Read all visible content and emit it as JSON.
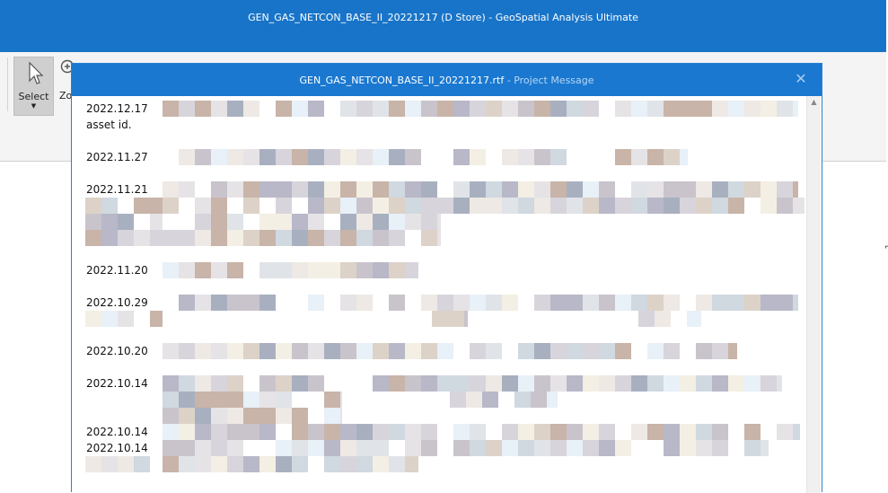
{
  "app": {
    "window_title": "GEN_GAS_NETCON_BASE_II_20221217 (D Store) - GeoSpatial Analysis Ultimate"
  },
  "ribbon": {
    "select_label": "Select",
    "zoom_label_partial": "Zo"
  },
  "dialog": {
    "file_name": "GEN_GAS_NETCON_BASE_II_20221217.rtf",
    "separator": " - ",
    "subtitle": "Project Message",
    "close_icon": "close-icon"
  },
  "messages": [
    {
      "date": "2022.12.17",
      "text": "asset id."
    },
    {
      "date": "2022.11.27"
    },
    {
      "date": "2022.11.21"
    },
    {
      "date": "2022.11.20"
    },
    {
      "date": "2022.10.29"
    },
    {
      "date": "2022.10.20"
    },
    {
      "date": "2022.10.14"
    },
    {
      "date": "2022.10.14"
    },
    {
      "date": "2022.10.14"
    }
  ],
  "colors": {
    "title_bar": "#1874c8",
    "dialog_title_bar": "#1a78d0",
    "redacted_palette": [
      "#e6e3e6",
      "#d8d4dc",
      "#c9c4cc",
      "#eee9e4",
      "#dcd2c8",
      "#c8b4a8",
      "#b8b8c8",
      "#a8b0c0",
      "#e8f0f8",
      "#d0d8e0",
      "#f4efe4",
      "#e0e4e8"
    ]
  }
}
